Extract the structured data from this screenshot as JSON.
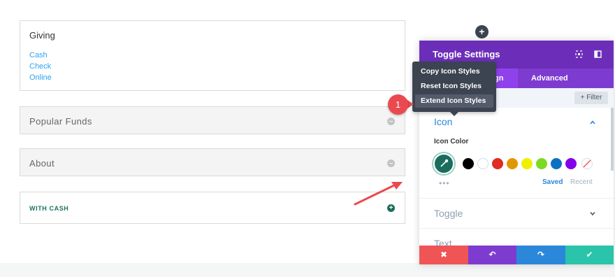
{
  "toggles": {
    "giving": {
      "title": "Giving",
      "links": [
        "Cash",
        "Check",
        "Online"
      ]
    },
    "popular_funds": {
      "title": "Popular Funds"
    },
    "about": {
      "title": "About"
    },
    "with_cash": {
      "title": "WITH CASH"
    }
  },
  "panel": {
    "title": "Toggle Settings",
    "tabs": {
      "design": "ign",
      "advanced": "Advanced"
    },
    "filter_label": "Filter",
    "icon_section": "Icon",
    "icon_color_label": "Icon Color",
    "swatches": [
      "#000000",
      "#ffffff",
      "#e02b20",
      "#e09900",
      "#edf000",
      "#7cda24",
      "#0c71c3",
      "#8300e9"
    ],
    "saved_label": "Saved",
    "recent_label": "Recent",
    "toggle_section": "Toggle",
    "text_section": "Text",
    "dots": "•••"
  },
  "context_menu": {
    "items": [
      "Copy Icon Styles",
      "Reset Icon Styles",
      "Extend Icon Styles"
    ]
  },
  "annotation": {
    "step": "1"
  },
  "colors": {
    "purple_header": "#6c2eb9",
    "accent_blue": "#2b87da",
    "cancel": "#ef5555",
    "undo": "#7e3bd0",
    "redo": "#2b87da",
    "save": "#29c4a9",
    "annotation_red": "#ea4a4f"
  }
}
